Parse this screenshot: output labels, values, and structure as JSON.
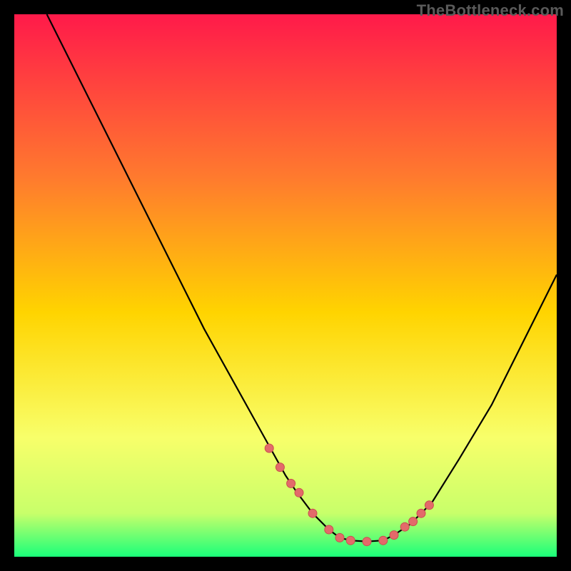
{
  "watermark": "TheBottleneck.com",
  "colors": {
    "background": "#000000",
    "gradient_top": "#ff1a4a",
    "gradient_mid1": "#ff7a2e",
    "gradient_mid2": "#ffd400",
    "gradient_low1": "#f8ff6a",
    "gradient_low2": "#c8ff6a",
    "gradient_bottom": "#1aff7a",
    "curve": "#000000",
    "marker_fill": "#e36a6a",
    "marker_stroke": "#c94f4f"
  },
  "chart_data": {
    "type": "line",
    "title": "",
    "xlabel": "",
    "ylabel": "",
    "xlim": [
      0,
      100
    ],
    "ylim": [
      0,
      100
    ],
    "series": [
      {
        "name": "bottleneck-curve",
        "x": [
          6,
          10,
          15,
          20,
          25,
          30,
          35,
          40,
          45,
          50,
          52,
          55,
          58,
          60,
          62,
          65,
          68,
          70,
          73,
          77,
          82,
          88,
          94,
          100
        ],
        "y": [
          100,
          92,
          82,
          72,
          62,
          52,
          42,
          33,
          24,
          15,
          12,
          8,
          5,
          3.5,
          3,
          2.8,
          3,
          4,
          6,
          10,
          18,
          28,
          40,
          52
        ]
      }
    ],
    "markers": {
      "name": "highlight-points",
      "x": [
        47,
        49,
        51,
        52.5,
        55,
        58,
        60,
        62,
        65,
        68,
        70,
        72,
        73.5,
        75,
        76.5
      ],
      "y": [
        20,
        16.5,
        13.5,
        11.8,
        8,
        5,
        3.5,
        3,
        2.8,
        3,
        4,
        5.5,
        6.5,
        8,
        9.5
      ]
    }
  }
}
